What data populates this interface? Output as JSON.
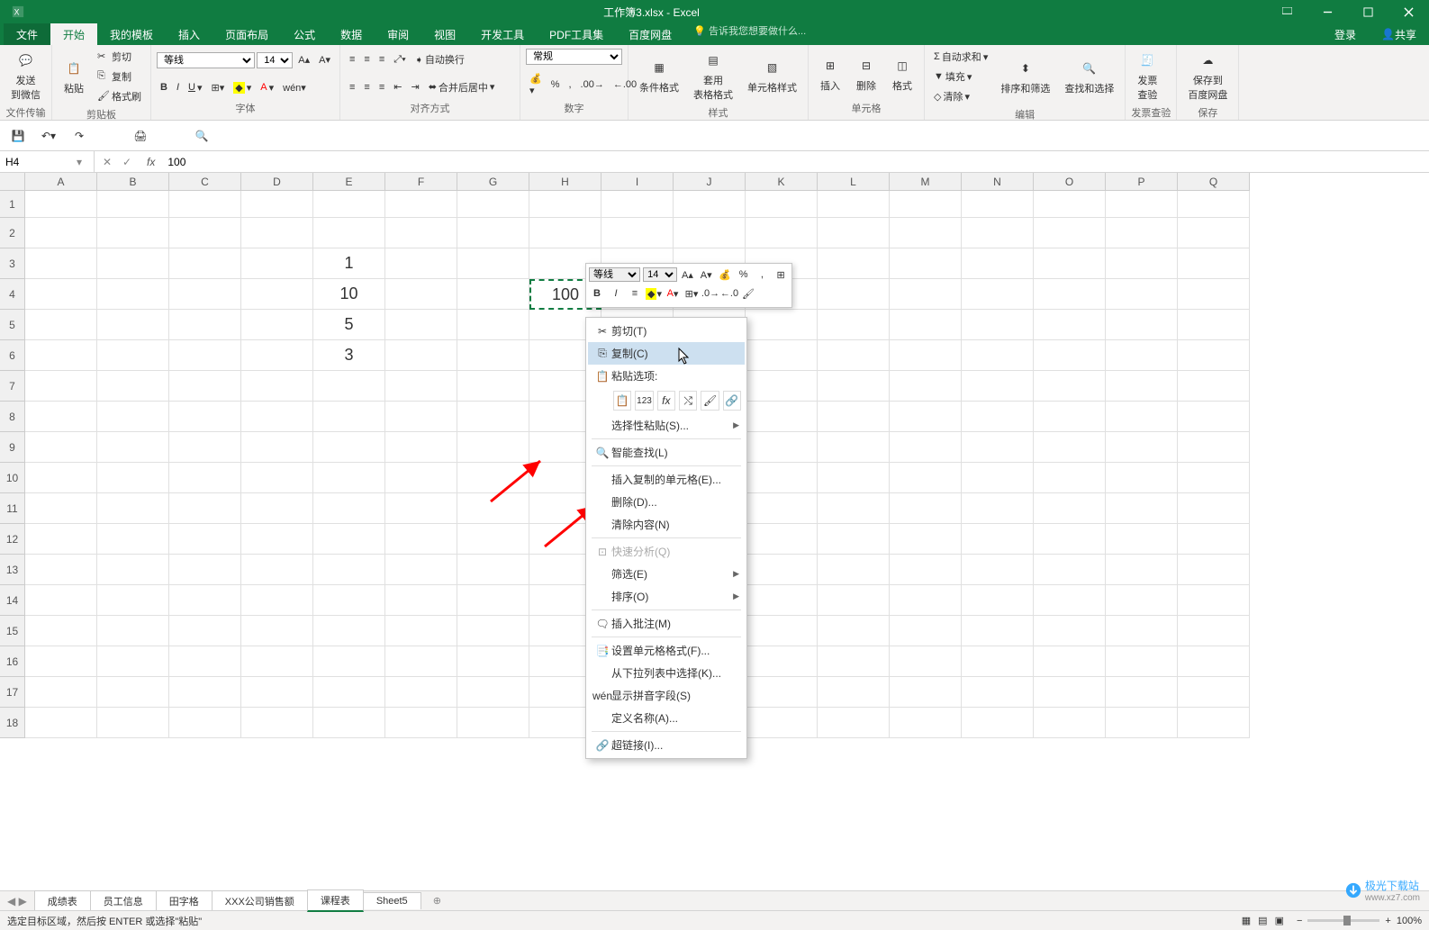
{
  "title": "工作簿3.xlsx - Excel",
  "tabs": {
    "file": "文件",
    "home": "开始",
    "mytpl": "我的模板",
    "insert": "插入",
    "layout": "页面布局",
    "formula": "公式",
    "data": "数据",
    "review": "审阅",
    "view": "视图",
    "dev": "开发工具",
    "pdf": "PDF工具集",
    "baidu": "百度网盘",
    "tell": "告诉我您想要做什么...",
    "login": "登录",
    "share": "共享"
  },
  "ribbon": {
    "g1": {
      "send": "发送\n到微信",
      "label": "文件传输"
    },
    "g2": {
      "paste": "粘贴",
      "cut": "剪切",
      "copy": "复制",
      "brush": "格式刷",
      "label": "剪贴板"
    },
    "g3": {
      "font": "等线",
      "size": "14",
      "label": "字体"
    },
    "g4": {
      "wrap": "自动换行",
      "merge": "合并后居中",
      "label": "对齐方式"
    },
    "g5": {
      "fmt": "常规",
      "label": "数字"
    },
    "g6": {
      "cond": "条件格式",
      "table": "套用\n表格格式",
      "cell": "单元格样式",
      "label": "样式"
    },
    "g7": {
      "ins": "插入",
      "del": "删除",
      "fmt": "格式",
      "label": "单元格"
    },
    "g8": {
      "sum": "自动求和",
      "fill": "填充",
      "clear": "清除",
      "sort": "排序和筛选",
      "find": "查找和选择",
      "label": "编辑"
    },
    "g9": {
      "inv": "发票\n查验",
      "label": "发票查验"
    },
    "g10": {
      "save": "保存到\n百度网盘",
      "label": "保存"
    }
  },
  "namebox": {
    "ref": "H4"
  },
  "formula": {
    "value": "100"
  },
  "cols": [
    "A",
    "B",
    "C",
    "D",
    "E",
    "F",
    "G",
    "H",
    "I",
    "J",
    "K",
    "L",
    "M",
    "N",
    "O",
    "P",
    "Q"
  ],
  "rows": [
    "1",
    "2",
    "3",
    "4",
    "5",
    "6",
    "7",
    "8",
    "9",
    "10",
    "11",
    "12",
    "13",
    "14",
    "15",
    "16",
    "17",
    "18"
  ],
  "cells": {
    "E3": "1",
    "E4": "10",
    "E5": "5",
    "E6": "3",
    "H4": "100"
  },
  "mini": {
    "font": "等线",
    "size": "14"
  },
  "ctx": {
    "cut": "剪切(T)",
    "copy": "复制(C)",
    "pasteopt": "粘贴选项:",
    "pastespecial": "选择性粘贴(S)...",
    "smartfind": "智能查找(L)",
    "inscopied": "插入复制的单元格(E)...",
    "delete": "删除(D)...",
    "clear": "清除内容(N)",
    "quickanalysis": "快速分析(Q)",
    "filter": "筛选(E)",
    "sort": "排序(O)",
    "comment": "插入批注(M)",
    "fmtcell": "设置单元格格式(F)...",
    "dropdown": "从下拉列表中选择(K)...",
    "phonetic": "显示拼音字段(S)",
    "defname": "定义名称(A)...",
    "hyperlink": "超链接(I)..."
  },
  "sheets": {
    "s1": "成绩表",
    "s2": "员工信息",
    "s3": "田字格",
    "s4": "XXX公司销售额",
    "s5": "课程表",
    "s6": "Sheet5"
  },
  "status": {
    "text": "选定目标区域，然后按 ENTER 或选择\"粘贴\"",
    "zoom": "100%"
  },
  "watermark": {
    "text": "极光下载站",
    "url": "www.xz7.com"
  }
}
